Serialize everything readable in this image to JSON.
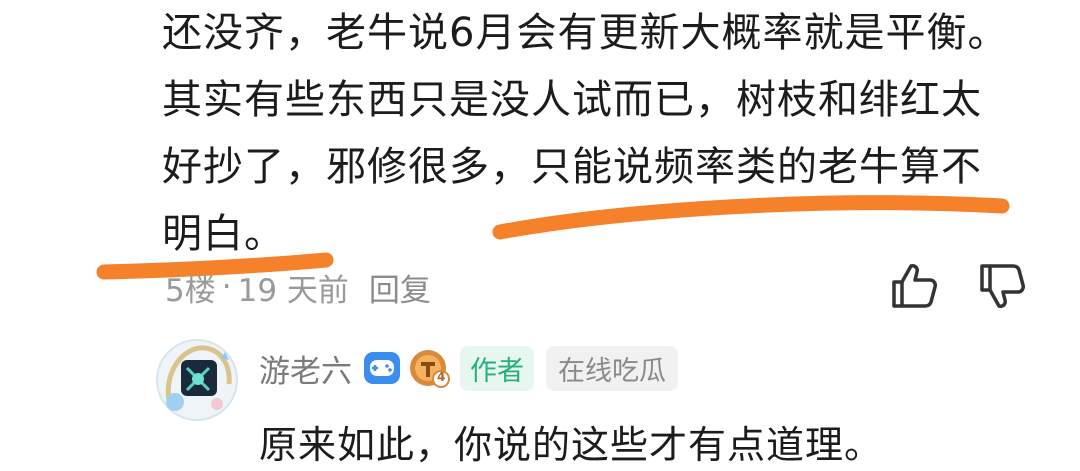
{
  "comment": {
    "lines": [
      "还没齐，老牛说6月会有更新大概率就是平衡。",
      "其实有些东西只是没人试而已，树枝和绯红太",
      "好抄了，邪修很多，只能说频率类的老牛算不",
      "明白。"
    ],
    "floor": "5楼",
    "separator": "·",
    "time": "19 天前",
    "reply_label": "回复",
    "like_icon": "thumbs-up-icon",
    "dislike_icon": "thumbs-down-icon"
  },
  "reply": {
    "username": "游老六",
    "badge_icons": [
      "gamepad-badge-icon",
      "level-badge-icon"
    ],
    "level": "4",
    "author_tag": "作者",
    "status_tag": "在线吃瓜",
    "text": "原来如此，你说的这些才有点道理。"
  },
  "colors": {
    "annotation": "#f5822a",
    "author_tag": "#27b07a",
    "text": "#1c1c1c",
    "meta": "#9a9a9a"
  }
}
